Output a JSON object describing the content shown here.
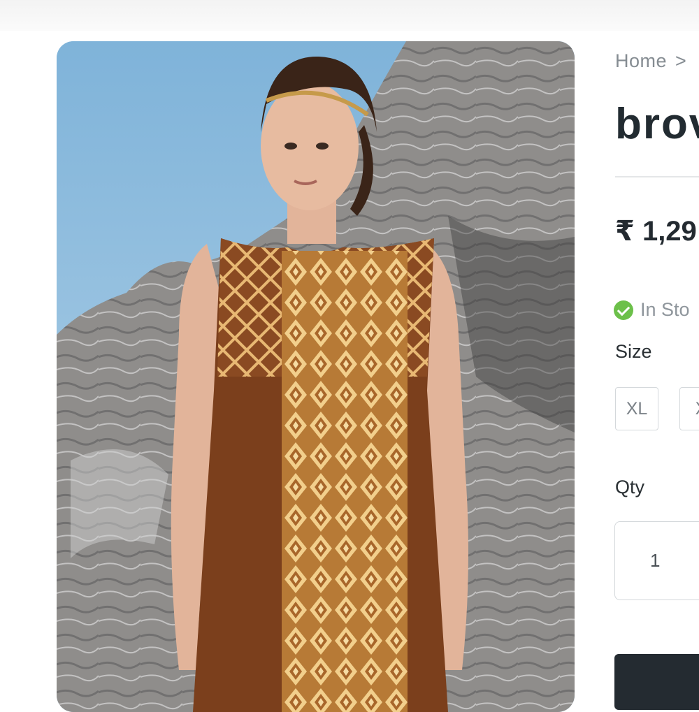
{
  "breadcrumb": {
    "home": "Home",
    "separator": ">"
  },
  "product": {
    "title": "brov",
    "price": "₹ 1,29",
    "stock_label": "In Sto",
    "size_label": "Size",
    "sizes": [
      "XL",
      "X"
    ],
    "qty_label": "Qty",
    "qty_value": "1"
  },
  "colors": {
    "accent_dark": "#242b31",
    "in_stock": "#6cc04a",
    "muted_text": "#858c92"
  }
}
